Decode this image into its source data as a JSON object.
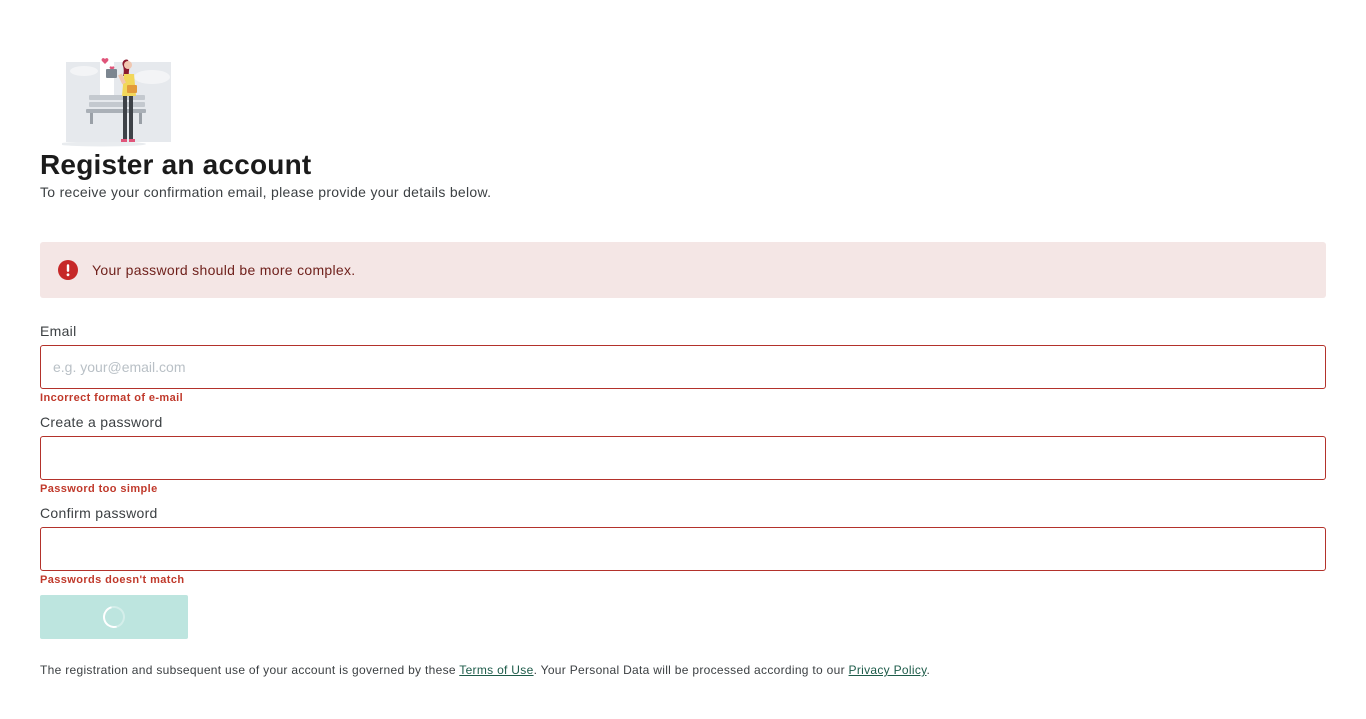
{
  "header": {
    "title": "Register an account",
    "subtitle": "To receive your confirmation email, please provide your details below."
  },
  "alert": {
    "message": "Your password should be more complex.",
    "icon": "error-icon",
    "color": "#c62828"
  },
  "form": {
    "email": {
      "label": "Email",
      "value": "",
      "placeholder": "e.g. your@email.com",
      "error": "Incorrect format of e-mail"
    },
    "password": {
      "label": "Create a password",
      "value": "",
      "placeholder": "",
      "error": "Password too simple"
    },
    "confirm_password": {
      "label": "Confirm password",
      "value": "",
      "placeholder": "",
      "error": "Passwords doesn't match"
    },
    "submit": {
      "state": "loading",
      "icon": "spinner-icon",
      "color": "#bde5df"
    }
  },
  "footer": {
    "text_before": "The registration and subsequent use of your account is governed by these ",
    "terms_link": "Terms of Use",
    "text_middle": ". Your Personal Data will be processed according to our ",
    "privacy_link": "Privacy Policy",
    "text_after": "."
  },
  "colors": {
    "error": "#c0392b",
    "alert_background": "#f4e6e5",
    "link": "#1d5b49",
    "button_disabled": "#bde5df"
  }
}
